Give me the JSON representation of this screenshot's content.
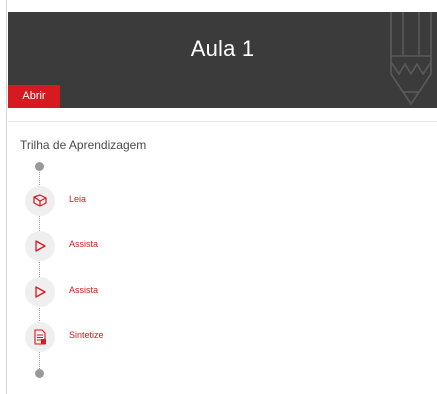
{
  "header": {
    "title": "Aula 1",
    "open_label": "Abrir",
    "background": "#3b3b3b"
  },
  "section": {
    "title": "Trilha de Aprendizagem"
  },
  "steps": [
    {
      "label": "Leia",
      "icon": "book-icon"
    },
    {
      "label": "Assista",
      "icon": "play-icon"
    },
    {
      "label": "Assista",
      "icon": "play-icon"
    },
    {
      "label": "Sintetize",
      "icon": "document-icon"
    }
  ],
  "colors": {
    "accent": "#d71920",
    "muted": "#9a9a9a"
  }
}
